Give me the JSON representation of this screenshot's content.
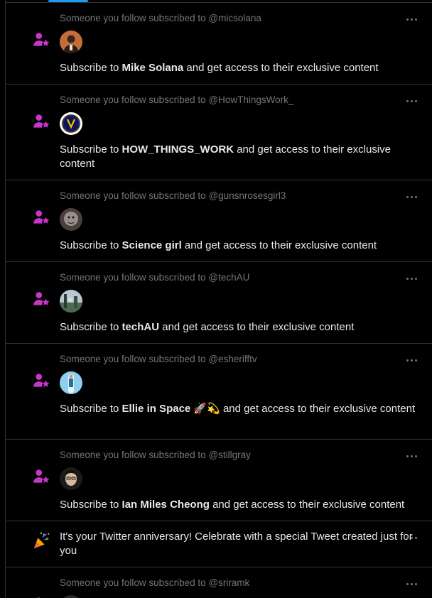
{
  "notifications": [
    {
      "context": "Someone you follow subscribed to @micsolana",
      "prefix": "Subscribe to ",
      "name": "Mike Solana",
      "suffix": " and get access to their exclusive content",
      "avatar_colors": [
        "#c56d3a",
        "#3a2418"
      ]
    },
    {
      "context": "Someone you follow subscribed to @HowThingsWork_",
      "prefix": "Subscribe to ",
      "name": "HOW_THINGS_WORK",
      "suffix": " and get access to their exclusive content",
      "avatar_colors": [
        "#ffffff",
        "#1a237e"
      ]
    },
    {
      "context": "Someone you follow subscribed to @gunsnrosesgirl3",
      "prefix": "Subscribe to ",
      "name": "Science girl",
      "suffix": " and get access to their exclusive content",
      "avatar_colors": [
        "#9a8f8c",
        "#4a3f3c"
      ]
    },
    {
      "context": "Someone you follow subscribed to @techAU",
      "prefix": "Subscribe to ",
      "name": "techAU",
      "suffix": " and get access to their exclusive content",
      "avatar_colors": [
        "#4d6b52",
        "#b8c7d0"
      ]
    },
    {
      "context": "Someone you follow subscribed to @esherifftv",
      "prefix": "Subscribe to ",
      "name": "Ellie in Space 🚀💫",
      "suffix": " and get access to their exclusive content",
      "avatar_colors": [
        "#8fd0ee",
        "#2e6e96"
      ]
    },
    {
      "context": "Someone you follow subscribed to @stillgray",
      "prefix": "Subscribe to ",
      "name": "Ian Miles Cheong",
      "suffix": " and get access to their exclusive content",
      "avatar_colors": [
        "#1b1b1b",
        "#d9b79a"
      ]
    }
  ],
  "anniversary": {
    "icon": "party-popper-icon",
    "text": "It's your Twitter anniversary! Celebrate with a special Tweet created just for you"
  },
  "partial": {
    "context": "Someone you follow subscribed to @sriramk"
  },
  "colors": {
    "background": "#000000",
    "border": "#2f3336",
    "muted": "#71767b",
    "text": "#e7e9ea",
    "subscription_icon": "#c936cc",
    "accent": "#1d9bf0"
  }
}
